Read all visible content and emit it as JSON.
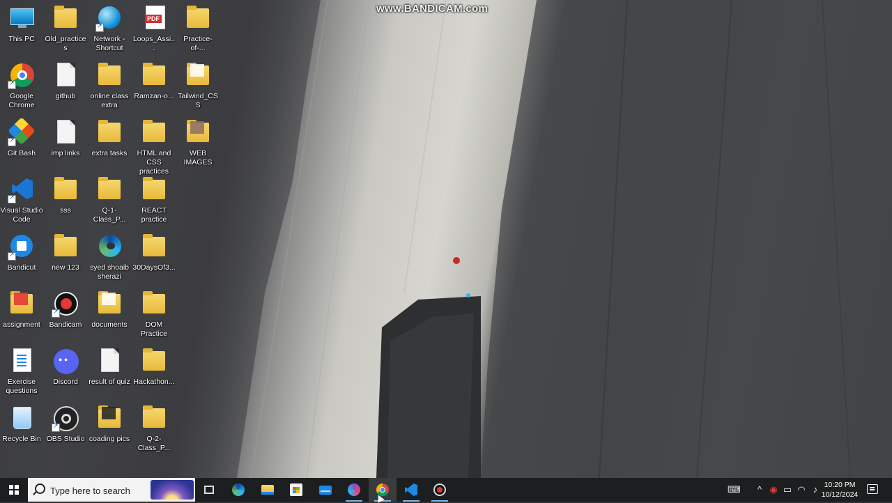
{
  "watermark": "www.BANDICAM.com",
  "desktop_icons": [
    {
      "label": "This PC",
      "icon": "this-pc-icon"
    },
    {
      "label": "Old_practices",
      "icon": "folder-icon"
    },
    {
      "label": "Network - Shortcut",
      "icon": "network-icon"
    },
    {
      "label": "Loops_Assi...",
      "icon": "pdf-icon"
    },
    {
      "label": "Practice-of-...",
      "icon": "folder-icon"
    },
    {
      "label": "Google Chrome",
      "icon": "chrome-icon"
    },
    {
      "label": "github",
      "icon": "file-icon"
    },
    {
      "label": "online class extra",
      "icon": "folder-icon"
    },
    {
      "label": "Ramzan-o...",
      "icon": "folder-icon"
    },
    {
      "label": "Tailwind_CSS",
      "icon": "folder-icon"
    },
    {
      "label": "Git Bash",
      "icon": "git-bash-icon"
    },
    {
      "label": "imp links",
      "icon": "file-icon"
    },
    {
      "label": "extra tasks",
      "icon": "folder-icon"
    },
    {
      "label": "HTML and CSS practices",
      "icon": "folder-icon"
    },
    {
      "label": "WEB IMAGES",
      "icon": "folder-icon"
    },
    {
      "label": "Visual Studio Code",
      "icon": "vscode-icon"
    },
    {
      "label": "sss",
      "icon": "folder-icon"
    },
    {
      "label": "Q-1-Class_P...",
      "icon": "folder-icon"
    },
    {
      "label": "REACT practice",
      "icon": "folder-icon"
    },
    {
      "label": "Bandicut",
      "icon": "bandicut-icon"
    },
    {
      "label": "new 123",
      "icon": "folder-icon"
    },
    {
      "label": "syed shoaib sherazi",
      "icon": "edge-icon"
    },
    {
      "label": "30DaysOf3...",
      "icon": "folder-icon"
    },
    {
      "label": "assignment",
      "icon": "folder-icon"
    },
    {
      "label": "Bandicam",
      "icon": "bandicam-icon"
    },
    {
      "label": "documents",
      "icon": "folder-icon"
    },
    {
      "label": "DOM Practice",
      "icon": "folder-icon"
    },
    {
      "label": "Exercise questions",
      "icon": "word-doc-icon"
    },
    {
      "label": "Discord",
      "icon": "discord-icon"
    },
    {
      "label": "result of quiz",
      "icon": "file-icon"
    },
    {
      "label": "Hackathon...",
      "icon": "folder-icon"
    },
    {
      "label": "Recycle Bin",
      "icon": "recycle-bin-icon"
    },
    {
      "label": "OBS Studio",
      "icon": "obs-icon"
    },
    {
      "label": "coading pics",
      "icon": "folder-icon"
    },
    {
      "label": "Q-2-Class_P...",
      "icon": "folder-icon"
    }
  ],
  "taskbar": {
    "search_placeholder": "Type here to search",
    "apps": [
      "task-view-icon",
      "edge-icon",
      "file-explorer-icon",
      "microsoft-store-icon",
      "mail-icon",
      "chat-icon",
      "chrome-icon",
      "vscode-icon",
      "bandicam-icon"
    ],
    "active_app": "chrome-icon"
  },
  "tray": {
    "time": "10:20 PM",
    "date": "10/12/2024"
  }
}
